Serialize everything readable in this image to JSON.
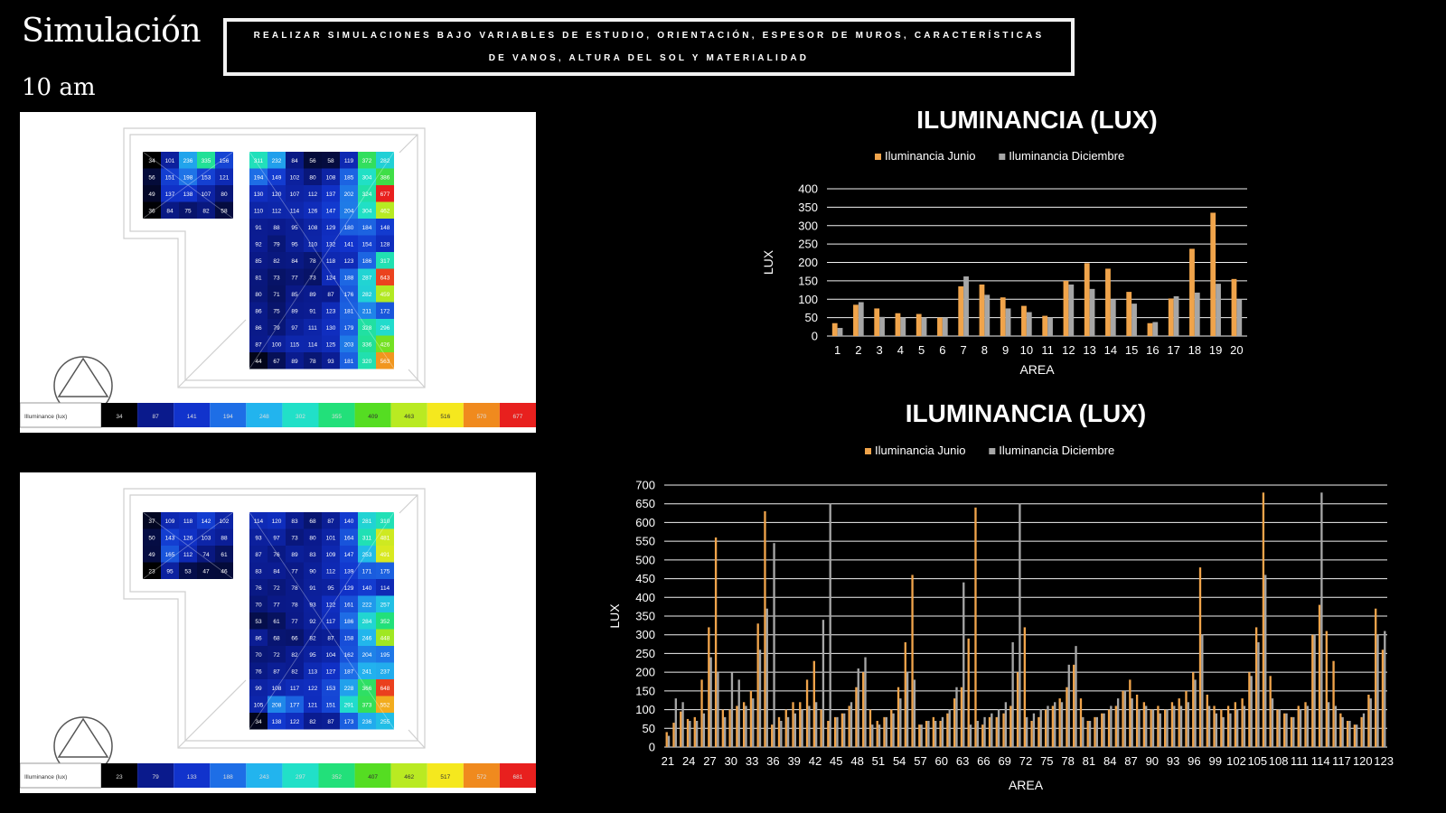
{
  "page": {
    "title": "Simulación",
    "time_label": "10 am",
    "banner": "REALIZAR SIMULACIONES BAJO VARIABLES DE ESTUDIO, ORIENTACIÓN, ESPESOR DE MUROS, CARACTERÍSTICAS DE VANOS, ALTURA DEL SOL Y MATERIALIDAD"
  },
  "simulations": [
    {
      "legend_label": "Illuminance (lux)",
      "legend_values": [
        "34",
        "87",
        "141",
        "194",
        "248",
        "302",
        "355",
        "409",
        "463",
        "516",
        "570",
        "677"
      ],
      "legend_colors": [
        "#000000",
        "#0a1a8c",
        "#1133cc",
        "#1e6ee6",
        "#22b4ee",
        "#21e0c8",
        "#22e07a",
        "#55dd22",
        "#b9ea22",
        "#f5e81e",
        "#f08a1e",
        "#e8201e"
      ],
      "left_grid": [
        [
          "34",
          "101",
          "236",
          "335",
          "156"
        ],
        [
          "56",
          "151",
          "198",
          "153",
          "121"
        ],
        [
          "49",
          "137",
          "138",
          "107",
          "80"
        ],
        [
          "36",
          "84",
          "75",
          "82",
          "58"
        ]
      ],
      "right_grid": [
        [
          "311",
          "232",
          "84",
          "56",
          "58",
          "119",
          "372",
          "282"
        ],
        [
          "194",
          "149",
          "102",
          "80",
          "108",
          "185",
          "304",
          "386"
        ],
        [
          "130",
          "120",
          "107",
          "112",
          "137",
          "202",
          "324",
          "677"
        ],
        [
          "110",
          "112",
          "114",
          "126",
          "147",
          "204",
          "304",
          "462"
        ],
        [
          "91",
          "88",
          "95",
          "108",
          "129",
          "180",
          "184",
          "148"
        ],
        [
          "92",
          "79",
          "95",
          "110",
          "132",
          "141",
          "154",
          "128"
        ],
        [
          "85",
          "82",
          "84",
          "78",
          "118",
          "123",
          "186",
          "317"
        ],
        [
          "81",
          "73",
          "77",
          "73",
          "124",
          "188",
          "287",
          "643"
        ],
        [
          "80",
          "71",
          "85",
          "89",
          "87",
          "176",
          "282",
          "459"
        ],
        [
          "86",
          "75",
          "89",
          "91",
          "123",
          "181",
          "211",
          "172"
        ],
        [
          "86",
          "79",
          "97",
          "111",
          "130",
          "179",
          "328",
          "296"
        ],
        [
          "87",
          "100",
          "115",
          "114",
          "125",
          "203",
          "336",
          "426"
        ],
        [
          "44",
          "67",
          "89",
          "78",
          "93",
          "181",
          "320",
          "563"
        ]
      ]
    },
    {
      "legend_label": "Illuminance (lux)",
      "legend_values": [
        "23",
        "79",
        "133",
        "188",
        "243",
        "297",
        "352",
        "407",
        "462",
        "517",
        "572",
        "681"
      ],
      "legend_colors": [
        "#000000",
        "#0a1a8c",
        "#1133cc",
        "#1e6ee6",
        "#22b4ee",
        "#21e0c8",
        "#22e07a",
        "#55dd22",
        "#b9ea22",
        "#f5e81e",
        "#f08a1e",
        "#e8201e"
      ],
      "left_grid": [
        [
          "37",
          "109",
          "118",
          "142",
          "102"
        ],
        [
          "50",
          "143",
          "126",
          "103",
          "88"
        ],
        [
          "49",
          "165",
          "112",
          "74",
          "61"
        ],
        [
          "23",
          "95",
          "53",
          "47",
          "46"
        ]
      ],
      "right_grid": [
        [
          "114",
          "120",
          "83",
          "68",
          "87",
          "140",
          "281",
          "310"
        ],
        [
          "93",
          "97",
          "73",
          "80",
          "101",
          "164",
          "311",
          "481"
        ],
        [
          "87",
          "76",
          "89",
          "83",
          "109",
          "147",
          "253",
          "491"
        ],
        [
          "83",
          "84",
          "77",
          "90",
          "112",
          "139",
          "171",
          "175"
        ],
        [
          "76",
          "72",
          "78",
          "91",
          "95",
          "129",
          "140",
          "114"
        ],
        [
          "70",
          "77",
          "78",
          "93",
          "122",
          "161",
          "222",
          "257"
        ],
        [
          "53",
          "61",
          "77",
          "92",
          "117",
          "186",
          "284",
          "352"
        ],
        [
          "86",
          "68",
          "66",
          "82",
          "87",
          "158",
          "246",
          "448"
        ],
        [
          "70",
          "72",
          "82",
          "95",
          "104",
          "162",
          "204",
          "195"
        ],
        [
          "76",
          "87",
          "82",
          "113",
          "127",
          "187",
          "241",
          "237"
        ],
        [
          "99",
          "108",
          "117",
          "122",
          "153",
          "228",
          "366",
          "648"
        ],
        [
          "105",
          "208",
          "177",
          "121",
          "151",
          "291",
          "373",
          "552"
        ],
        [
          "34",
          "138",
          "122",
          "82",
          "87",
          "173",
          "236",
          "255"
        ]
      ]
    }
  ],
  "chart_data": [
    {
      "type": "bar",
      "title": "ILUMINANCIA (LUX)",
      "xlabel": "AREA",
      "ylabel": "LUX",
      "ylim": [
        0,
        400
      ],
      "yticks": [
        0,
        50,
        100,
        150,
        200,
        250,
        300,
        350,
        400
      ],
      "grid": true,
      "legend_position": "top",
      "categories": [
        "1",
        "2",
        "3",
        "4",
        "5",
        "6",
        "7",
        "8",
        "9",
        "10",
        "11",
        "12",
        "13",
        "14",
        "15",
        "16",
        "17",
        "18",
        "19",
        "20"
      ],
      "series": [
        {
          "name": "Iluminancia Junio",
          "color": "#f0a44b",
          "values": [
            35,
            85,
            75,
            62,
            60,
            50,
            135,
            140,
            105,
            82,
            55,
            150,
            198,
            183,
            120,
            35,
            102,
            237,
            335,
            155
          ]
        },
        {
          "name": "Iluminancia Diciembre",
          "color": "#a6a6a6",
          "values": [
            22,
            92,
            52,
            50,
            50,
            50,
            162,
            112,
            75,
            65,
            50,
            140,
            128,
            100,
            88,
            38,
            108,
            118,
            142,
            100
          ]
        }
      ]
    },
    {
      "type": "bar",
      "title": "ILUMINANCIA (LUX)",
      "xlabel": "AREA",
      "ylabel": "LUX",
      "ylim": [
        0,
        700
      ],
      "yticks": [
        0,
        50,
        100,
        150,
        200,
        250,
        300,
        350,
        400,
        450,
        500,
        550,
        600,
        650,
        700
      ],
      "grid": true,
      "legend_position": "top",
      "x_start": 21,
      "tick_labels": [
        "21",
        "24",
        "27",
        "30",
        "33",
        "36",
        "39",
        "42",
        "45",
        "48",
        "51",
        "54",
        "57",
        "60",
        "63",
        "66",
        "69",
        "72",
        "75",
        "78",
        "81",
        "84",
        "87",
        "90",
        "93",
        "96",
        "99",
        "102",
        "105",
        "108",
        "111",
        "114",
        "117",
        "120",
        "123"
      ],
      "series": [
        {
          "name": "Iluminancia Junio",
          "color": "#f0a44b",
          "values": [
            40,
            65,
            95,
            75,
            80,
            180,
            320,
            560,
            100,
            100,
            110,
            120,
            150,
            330,
            630,
            60,
            80,
            100,
            120,
            120,
            180,
            230,
            100,
            70,
            80,
            90,
            110,
            160,
            200,
            100,
            70,
            80,
            100,
            160,
            280,
            460,
            60,
            70,
            80,
            70,
            90,
            130,
            160,
            290,
            640,
            60,
            80,
            80,
            90,
            110,
            200,
            320,
            70,
            80,
            100,
            110,
            130,
            160,
            220,
            130,
            70,
            80,
            90,
            100,
            110,
            150,
            180,
            140,
            120,
            100,
            110,
            100,
            120,
            130,
            150,
            200,
            480,
            140,
            110,
            100,
            110,
            120,
            130,
            200,
            320,
            680,
            190,
            100,
            90,
            80,
            110,
            120,
            300,
            380,
            310,
            230,
            90,
            70,
            60,
            80,
            140,
            370,
            260
          ]
        },
        {
          "name": "Iluminancia Diciembre",
          "color": "#a6a6a6",
          "values": [
            30,
            130,
            120,
            70,
            70,
            90,
            240,
            200,
            80,
            200,
            180,
            110,
            130,
            260,
            370,
            545,
            70,
            80,
            90,
            100,
            110,
            120,
            340,
            650,
            80,
            90,
            120,
            210,
            240,
            60,
            60,
            80,
            90,
            130,
            200,
            180,
            60,
            70,
            70,
            80,
            100,
            160,
            440,
            60,
            70,
            80,
            90,
            100,
            120,
            280,
            650,
            80,
            90,
            100,
            110,
            120,
            120,
            220,
            270,
            80,
            70,
            80,
            90,
            110,
            130,
            150,
            130,
            100,
            110,
            100,
            90,
            100,
            110,
            110,
            120,
            180,
            300,
            110,
            90,
            80,
            90,
            100,
            110,
            190,
            280,
            460,
            130,
            100,
            90,
            80,
            100,
            110,
            300,
            680,
            120,
            110,
            80,
            70,
            60,
            90,
            130,
            300,
            310
          ]
        }
      ]
    }
  ]
}
